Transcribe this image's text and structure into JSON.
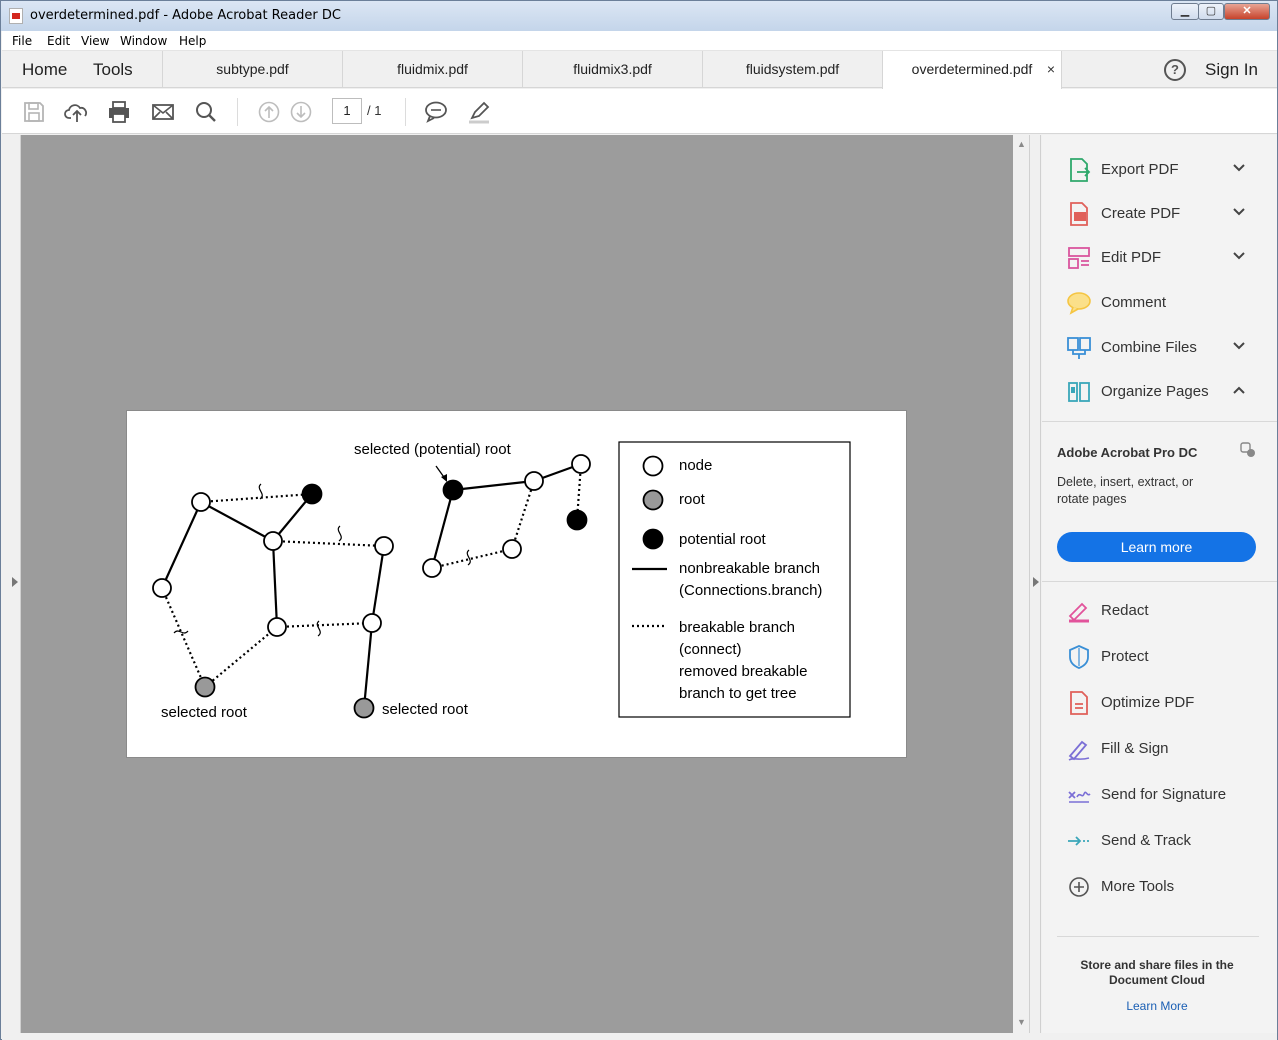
{
  "window": {
    "title": "overdetermined.pdf - Adobe Acrobat Reader DC",
    "min": "▁",
    "max": "▢",
    "close": "✕"
  },
  "menu": [
    "File",
    "Edit",
    "View",
    "Window",
    "Help"
  ],
  "nav": {
    "home": "Home",
    "tools": "Tools"
  },
  "tabs": [
    {
      "label": "subtype.pdf"
    },
    {
      "label": "fluidmix.pdf"
    },
    {
      "label": "fluidmix3.pdf"
    },
    {
      "label": "fluidsystem.pdf"
    },
    {
      "label": "overdetermined.pdf",
      "active": true,
      "close": "×"
    }
  ],
  "header": {
    "help": "?",
    "signin": "Sign In"
  },
  "toolbar": {
    "page_current": "1",
    "page_total": "/ 1"
  },
  "figure": {
    "label_potential_root": "selected (potential) root",
    "label_selected_root_1": "selected root",
    "label_selected_root_2": "selected root",
    "legend": {
      "node": "node",
      "root": "root",
      "potential_root": "potential root",
      "nonbreakable_1": "nonbreakable branch",
      "nonbreakable_2": "(Connections.branch)",
      "breakable_1": "breakable branch",
      "breakable_2": "(connect)",
      "removed_1": "removed breakable",
      "removed_2": "branch to get tree"
    }
  },
  "right_panel": {
    "tools": [
      {
        "label": "Export PDF",
        "icon": "export-pdf-icon",
        "color": "#2fa86c",
        "chevron": "down"
      },
      {
        "label": "Create PDF",
        "icon": "create-pdf-icon",
        "color": "#e0605a",
        "chevron": "down"
      },
      {
        "label": "Edit PDF",
        "icon": "edit-pdf-icon",
        "color": "#d9559e",
        "chevron": "down"
      },
      {
        "label": "Comment",
        "icon": "comment-icon",
        "color": "#f5c542",
        "chevron": ""
      },
      {
        "label": "Combine Files",
        "icon": "combine-files-icon",
        "color": "#3a8fd6",
        "chevron": "down"
      },
      {
        "label": "Organize Pages",
        "icon": "organize-pages-icon",
        "color": "#3aa6b9",
        "chevron": "up"
      }
    ],
    "promo": {
      "title": "Adobe Acrobat Pro DC",
      "description": "Delete, insert, extract, or rotate pages",
      "button": "Learn more"
    },
    "more_tools": [
      {
        "label": "Redact",
        "icon": "redact-icon",
        "color": "#e2539b"
      },
      {
        "label": "Protect",
        "icon": "protect-icon",
        "color": "#3a8fd6"
      },
      {
        "label": "Optimize PDF",
        "icon": "optimize-pdf-icon",
        "color": "#e0605a"
      },
      {
        "label": "Fill & Sign",
        "icon": "fill-sign-icon",
        "color": "#7b6fd6"
      },
      {
        "label": "Send for Signature",
        "icon": "send-signature-icon",
        "color": "#7b6fd6"
      },
      {
        "label": "Send & Track",
        "icon": "send-track-icon",
        "color": "#3aa6b9"
      },
      {
        "label": "More Tools",
        "icon": "more-tools-icon",
        "color": "#555555"
      }
    ],
    "cloud": {
      "text": "Store and share files in the Document Cloud",
      "link": "Learn More"
    }
  }
}
